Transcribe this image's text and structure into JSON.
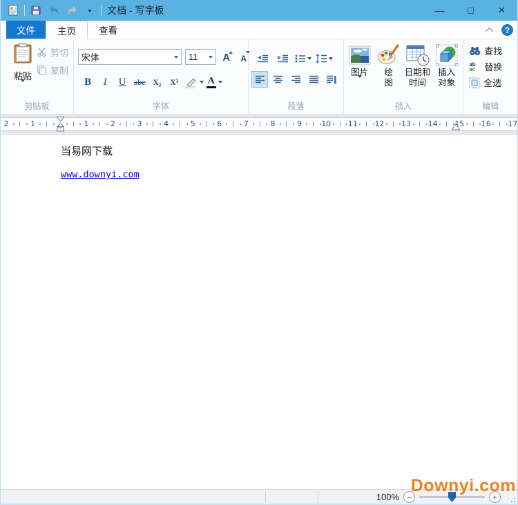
{
  "window": {
    "title": "文档 - 写字板",
    "minimize_glyph": "—",
    "maximize_glyph": "□",
    "close_glyph": "×",
    "help_glyph": "?"
  },
  "tabs": {
    "file": "文件",
    "home": "主页",
    "view": "查看"
  },
  "ribbon": {
    "clipboard": {
      "label": "剪贴板",
      "paste": "粘贴",
      "cut": "剪切",
      "copy": "复制"
    },
    "font": {
      "label": "字体",
      "family": "宋体",
      "size": "11"
    },
    "paragraph": {
      "label": "段落"
    },
    "insert": {
      "label": "插入",
      "picture": "图片",
      "drawing_l1": "绘",
      "drawing_l2": "图",
      "datetime_l1": "日期和",
      "datetime_l2": "时间",
      "object_l1": "插入",
      "object_l2": "对象"
    },
    "editing": {
      "label": "编辑",
      "find": "查找",
      "replace": "替换",
      "select_all": "全选"
    }
  },
  "icons": {
    "bold": "B",
    "italic": "I",
    "underline": "U",
    "strikethrough": "abe",
    "subscript": "X₂",
    "superscript": "X²",
    "grow_font": "A",
    "shrink_font": "A",
    "font_color": "A",
    "replace_top": "ab",
    "replace_bottom": "ac",
    "zoom_out": "−",
    "zoom_in": "+"
  },
  "ruler": {
    "labels": [
      "2",
      "1",
      "",
      "1",
      "2",
      "3",
      "4",
      "5",
      "6",
      "7",
      "8",
      "9",
      "10",
      "11",
      "12",
      "13",
      "14",
      "15",
      "16",
      "17"
    ]
  },
  "document": {
    "heading": "当易网下载",
    "link": "www.downyi.com"
  },
  "status": {
    "zoom_level": "100%"
  },
  "watermark": "Downyi.com",
  "colors": {
    "titlebar": "#5AB2E3",
    "file_tab": "#1779CE",
    "icon_blue": "#1F4E79",
    "arrow_blue": "#2E74B5",
    "selected_button_bg": "#CBE3F6",
    "link": "#0000D4",
    "watermark": "#F0801F"
  }
}
